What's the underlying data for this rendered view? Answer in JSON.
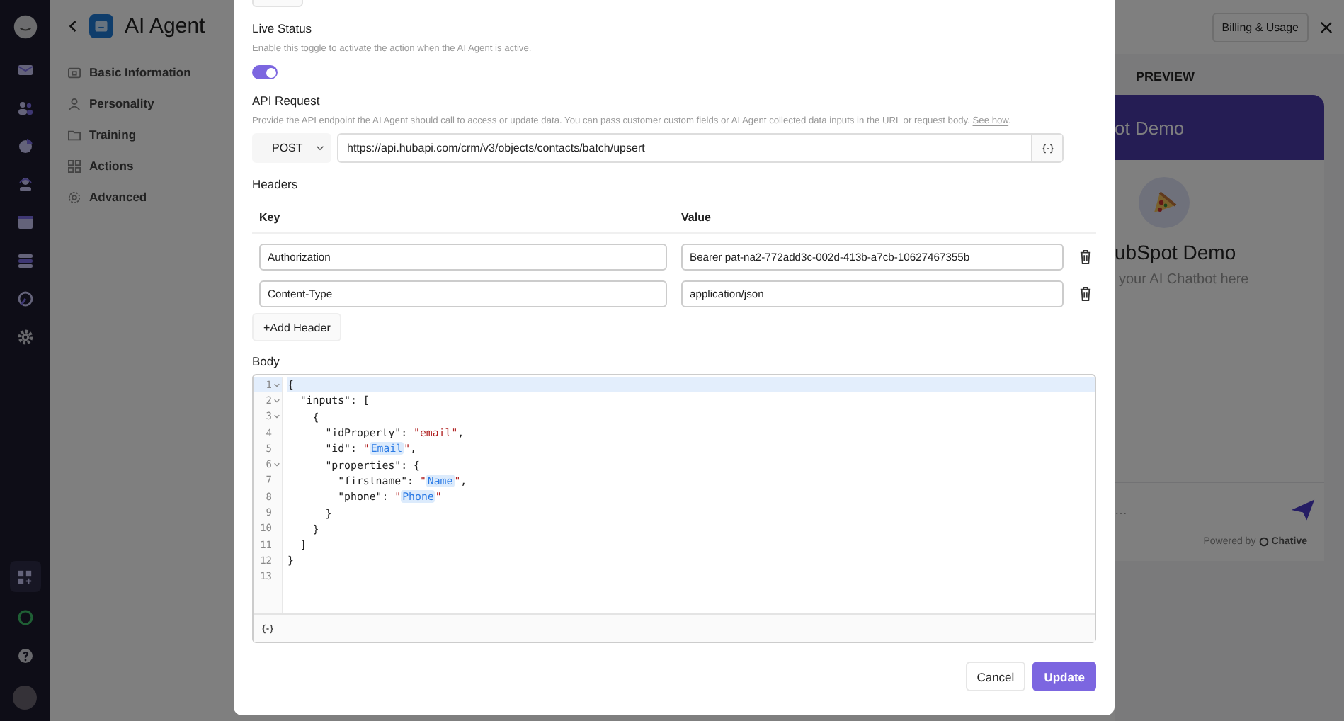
{
  "sidebar": {
    "title": "AI Agent",
    "items": [
      {
        "label": "Basic Information"
      },
      {
        "label": "Personality"
      },
      {
        "label": "Training"
      },
      {
        "label": "Actions"
      },
      {
        "label": "Advanced"
      }
    ]
  },
  "top_bar": {
    "billing_button": "Billing & Usage"
  },
  "preview": {
    "heading": "PREVIEW",
    "header_title": "ot Demo",
    "bot_name": "ubSpot Demo",
    "tagline": "your AI Chatbot here",
    "input_placeholder": "…",
    "powered_by": "Powered by",
    "brand": "Chative"
  },
  "modal": {
    "live_status": {
      "label": "Live Status",
      "description": "Enable this toggle to activate the action when the AI Agent is active.",
      "on": true
    },
    "api_request": {
      "label": "API Request",
      "description": "Provide the API endpoint the AI Agent should call to access or update data. You can pass customer custom fields or AI Agent collected data inputs in the URL or request body.",
      "link": "See how",
      "trailing": ".",
      "method": "POST",
      "url": "https://api.hubapi.com/crm/v3/objects/contacts/batch/upsert"
    },
    "headers": {
      "label": "Headers",
      "columns": [
        "Key",
        "Value"
      ],
      "rows": [
        {
          "key": "Authorization",
          "value": "Bearer pat-na2-772add3c-002d-413b-a7cb-10627467355b"
        },
        {
          "key": "Content-Type",
          "value": "application/json"
        }
      ],
      "add_button": "+Add Header"
    },
    "body": {
      "label": "Body",
      "lines": [
        {
          "number": "1",
          "fold": true,
          "active": true,
          "segments": [
            {
              "text": "{",
              "kind": "plain"
            }
          ]
        },
        {
          "number": "2",
          "fold": true,
          "active": false,
          "segments": [
            {
              "text": "  \"inputs\": [",
              "kind": "plain"
            }
          ]
        },
        {
          "number": "3",
          "fold": true,
          "active": false,
          "segments": [
            {
              "text": "    {",
              "kind": "plain"
            }
          ]
        },
        {
          "number": "4",
          "fold": false,
          "active": false,
          "segments": [
            {
              "text": "      \"idProperty\": ",
              "kind": "plain"
            },
            {
              "text": "\"email\"",
              "kind": "string"
            },
            {
              "text": ",",
              "kind": "plain"
            }
          ]
        },
        {
          "number": "5",
          "fold": false,
          "active": false,
          "segments": [
            {
              "text": "      \"id\": ",
              "kind": "plain"
            },
            {
              "text": "\"",
              "kind": "string"
            },
            {
              "text": "Email",
              "kind": "variable"
            },
            {
              "text": "\"",
              "kind": "string"
            },
            {
              "text": ",",
              "kind": "plain"
            }
          ]
        },
        {
          "number": "6",
          "fold": true,
          "active": false,
          "segments": [
            {
              "text": "      \"properties\": {",
              "kind": "plain"
            }
          ]
        },
        {
          "number": "7",
          "fold": false,
          "active": false,
          "segments": [
            {
              "text": "        \"firstname\": ",
              "kind": "plain"
            },
            {
              "text": "\"",
              "kind": "string"
            },
            {
              "text": "Name",
              "kind": "variable"
            },
            {
              "text": "\"",
              "kind": "string"
            },
            {
              "text": ",",
              "kind": "plain"
            }
          ]
        },
        {
          "number": "8",
          "fold": false,
          "active": false,
          "segments": [
            {
              "text": "        \"phone\": ",
              "kind": "plain"
            },
            {
              "text": "\"",
              "kind": "string"
            },
            {
              "text": "Phone",
              "kind": "variable"
            },
            {
              "text": "\"",
              "kind": "string"
            }
          ]
        },
        {
          "number": "9",
          "fold": false,
          "active": false,
          "segments": [
            {
              "text": "      }",
              "kind": "plain"
            }
          ]
        },
        {
          "number": "10",
          "fold": false,
          "active": false,
          "segments": [
            {
              "text": "    }",
              "kind": "plain"
            }
          ]
        },
        {
          "number": "11",
          "fold": false,
          "active": false,
          "segments": [
            {
              "text": "  ]",
              "kind": "plain"
            }
          ]
        },
        {
          "number": "12",
          "fold": false,
          "active": false,
          "segments": [
            {
              "text": "}",
              "kind": "plain"
            }
          ]
        },
        {
          "number": "13",
          "fold": false,
          "active": false
        }
      ]
    },
    "buttons": [
      {
        "label": "Cancel",
        "kind": "secondary"
      },
      {
        "label": "Update",
        "kind": "primary"
      }
    ]
  }
}
